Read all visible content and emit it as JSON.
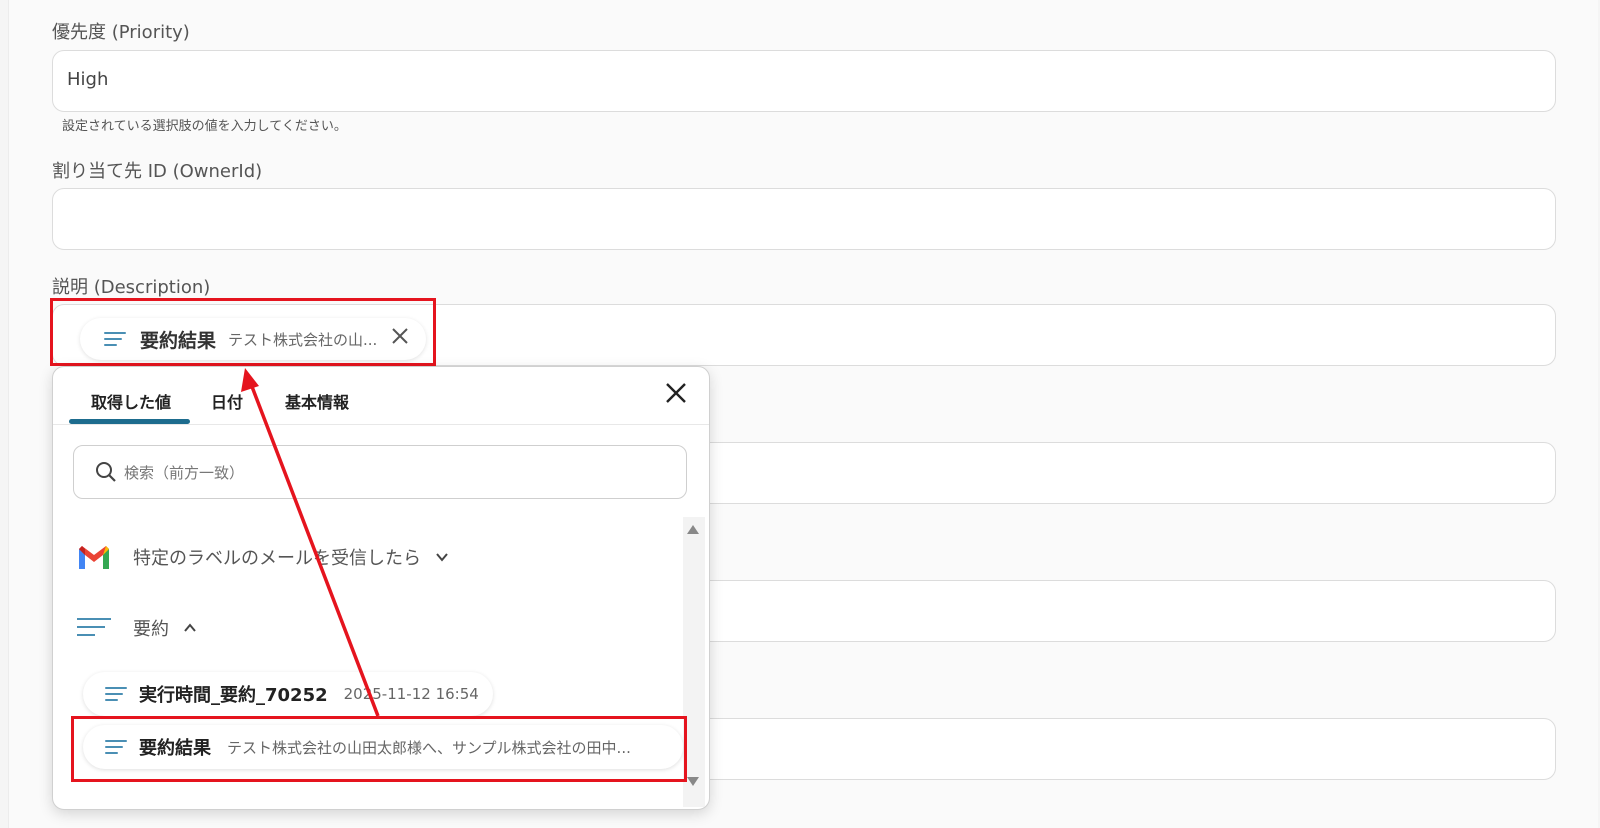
{
  "form": {
    "priority": {
      "label": "優先度 (Priority)",
      "value": "High",
      "hint": "設定されている選択肢の値を入力してください。"
    },
    "owner": {
      "label": "割り当て先 ID (OwnerId)",
      "value": ""
    },
    "description": {
      "label": "説明 (Description)",
      "token": {
        "name": "要約結果",
        "preview": "テスト株式会社の山...",
        "icon": "lines-icon"
      }
    }
  },
  "popup": {
    "tabs": [
      {
        "label": "取得した値",
        "active": true
      },
      {
        "label": "日付",
        "active": false
      },
      {
        "label": "基本情報",
        "active": false
      }
    ],
    "close_icon": "close-icon",
    "search": {
      "placeholder": "検索（前方一致）"
    },
    "groups": [
      {
        "label": "特定のラベルのメールを受信したら",
        "icon": "gmail-icon",
        "expanded": false
      },
      {
        "label": "要約",
        "icon": "lines-icon",
        "expanded": true
      }
    ],
    "items": [
      {
        "name": "実行時間_要約_70252",
        "value": "2025-11-12 16:54"
      },
      {
        "name": "要約結果",
        "value": "テスト株式会社の山田太郎様へ、サンプル株式会社の田中..."
      }
    ]
  },
  "colors": {
    "highlight": "#e5141e",
    "accent": "#1d6c8e",
    "icon_lines": "#4a8fb4"
  }
}
